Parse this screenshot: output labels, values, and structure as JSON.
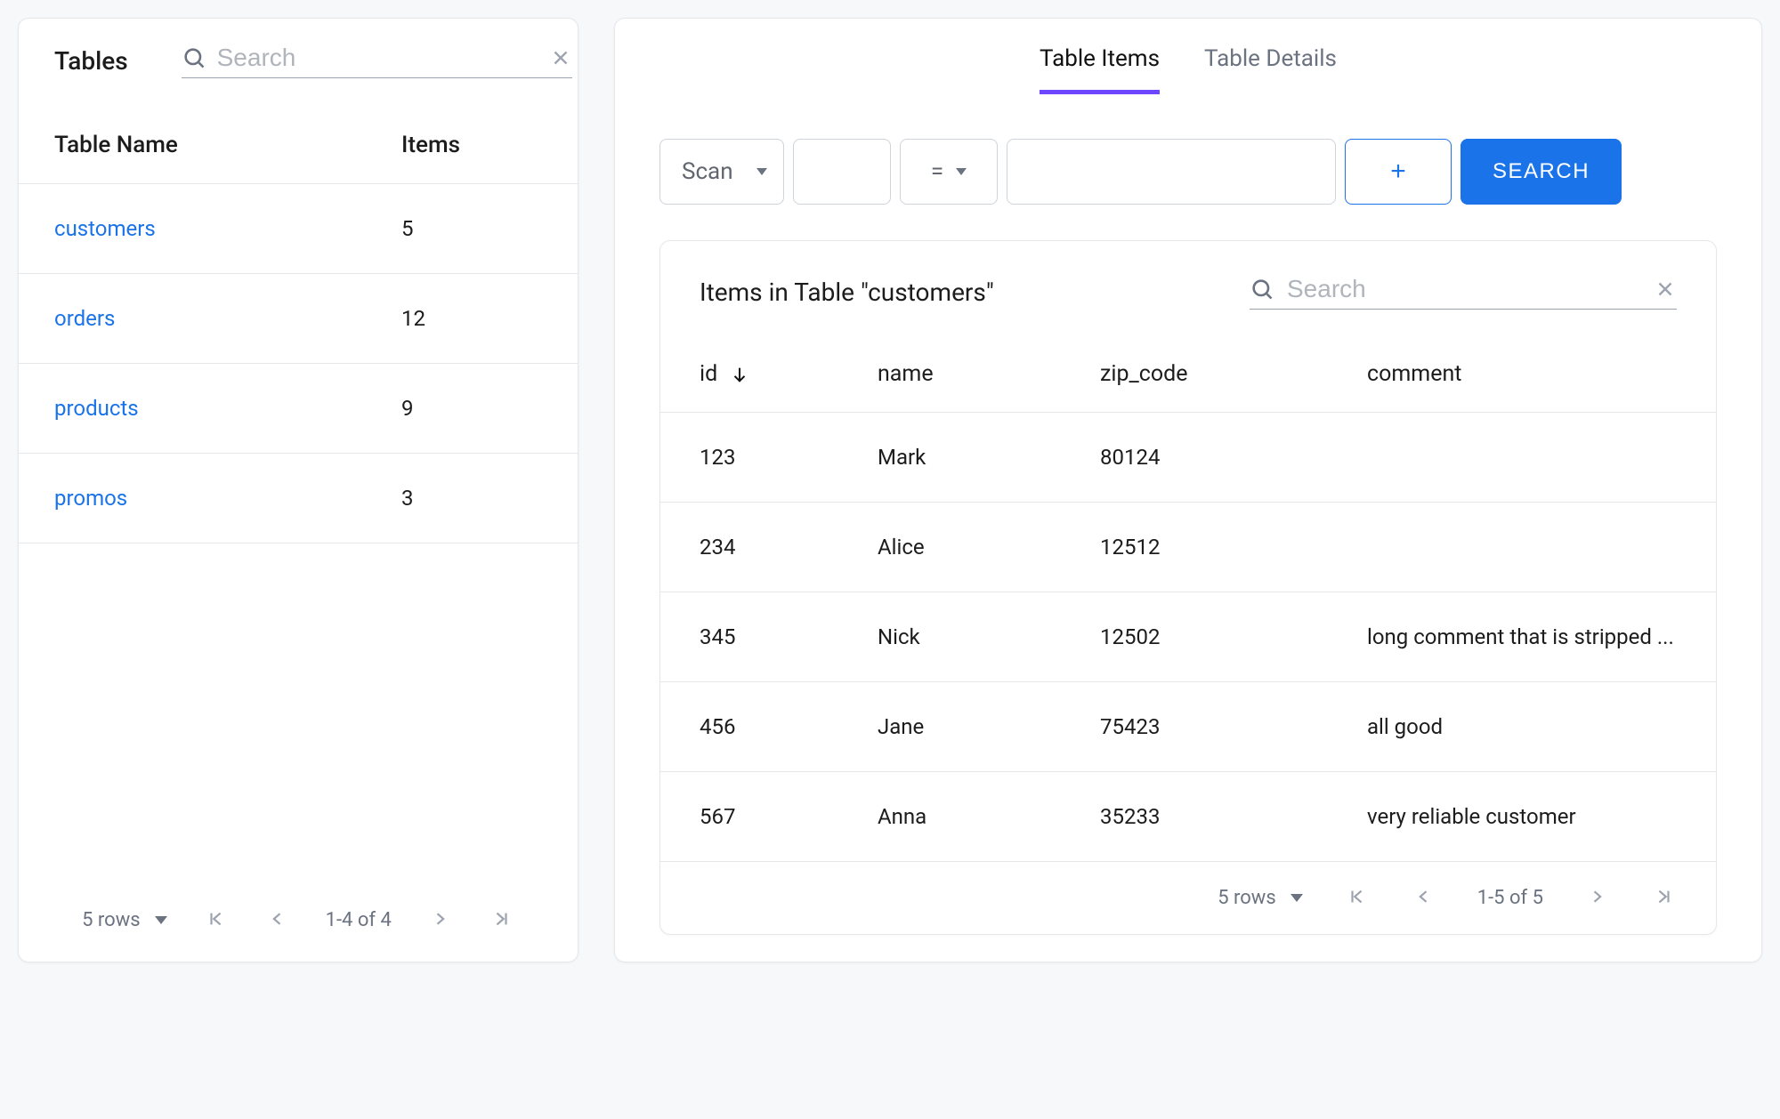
{
  "sidebar": {
    "title": "Tables",
    "search_placeholder": "Search",
    "columns": {
      "name": "Table Name",
      "items": "Items"
    },
    "rows": [
      {
        "name": "customers",
        "items": "5"
      },
      {
        "name": "orders",
        "items": "12"
      },
      {
        "name": "products",
        "items": "9"
      },
      {
        "name": "promos",
        "items": "3"
      }
    ],
    "pagination": {
      "rows_label": "5 rows",
      "range": "1-4 of 4"
    }
  },
  "main": {
    "tabs": {
      "items": "Table Items",
      "details": "Table Details",
      "active": "items"
    },
    "filter": {
      "scan_label": "Scan",
      "operator": "=",
      "add_label": "+",
      "search_label": "SEARCH"
    },
    "items": {
      "title": "Items in Table \"customers\"",
      "search_placeholder": "Search",
      "columns": {
        "id": "id",
        "name": "name",
        "zip": "zip_code",
        "comment": "comment"
      },
      "sort": {
        "column": "id",
        "direction": "asc"
      },
      "rows": [
        {
          "id": "123",
          "name": "Mark",
          "zip": "80124",
          "comment": ""
        },
        {
          "id": "234",
          "name": "Alice",
          "zip": "12512",
          "comment": ""
        },
        {
          "id": "345",
          "name": "Nick",
          "zip": "12502",
          "comment": "long comment that is stripped ..."
        },
        {
          "id": "456",
          "name": "Jane",
          "zip": "75423",
          "comment": "all good"
        },
        {
          "id": "567",
          "name": "Anna",
          "zip": "35233",
          "comment": "very reliable customer"
        }
      ],
      "pagination": {
        "rows_label": "5 rows",
        "range": "1-5 of 5"
      }
    }
  }
}
